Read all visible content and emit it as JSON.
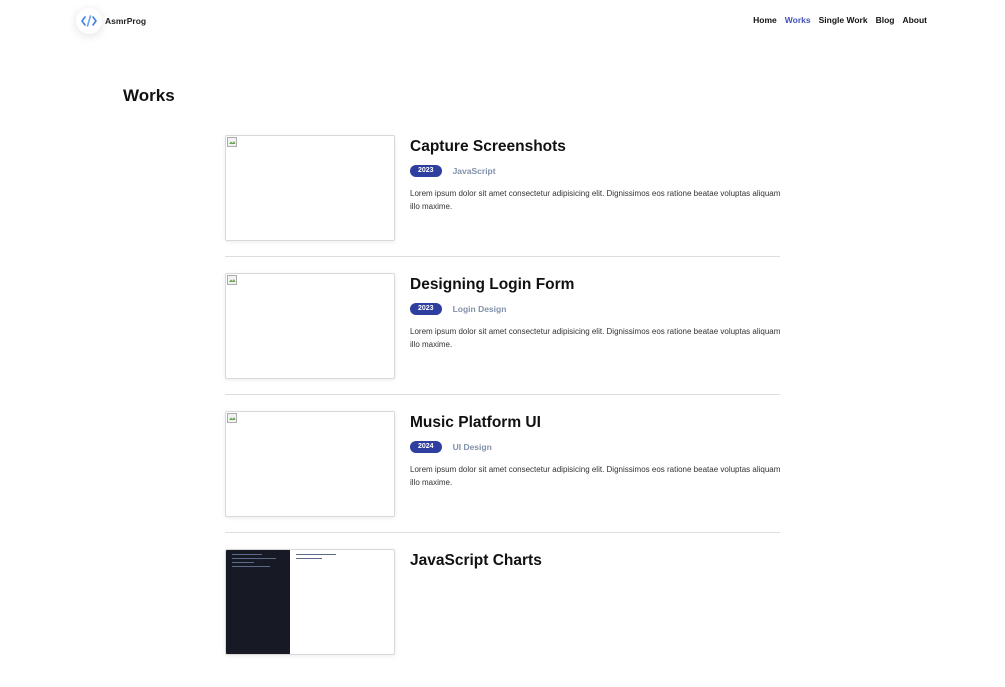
{
  "brand": {
    "name": "AsmrProg",
    "icon": "code-brackets-icon",
    "color": "#3f7fdc"
  },
  "nav": [
    {
      "label": "Home",
      "active": false
    },
    {
      "label": "Works",
      "active": true
    },
    {
      "label": "Single Work",
      "active": false
    },
    {
      "label": "Blog",
      "active": false
    },
    {
      "label": "About",
      "active": false
    }
  ],
  "page": {
    "title": "Works"
  },
  "colors": {
    "accent": "#3f51b5",
    "badge": "#2f3fa0",
    "category": "#8190aa"
  },
  "works": [
    {
      "title": "Capture Screenshots",
      "year": "2023",
      "category": "JavaScript",
      "description": "Lorem ipsum dolor sit amet consectetur adipisicing elit. Dignissimos eos ratione beatae voluptas aliquam illo maxime."
    },
    {
      "title": "Designing Login Form",
      "year": "2023",
      "category": "Login Design",
      "description": "Lorem ipsum dolor sit amet consectetur adipisicing elit. Dignissimos eos ratione beatae voluptas aliquam illo maxime."
    },
    {
      "title": "Music Platform UI",
      "year": "2024",
      "category": "UI Design",
      "description": "Lorem ipsum dolor sit amet consectetur adipisicing elit. Dignissimos eos ratione beatae voluptas aliquam illo maxime."
    },
    {
      "title": "JavaScript Charts",
      "year": "",
      "category": "",
      "description": ""
    }
  ]
}
